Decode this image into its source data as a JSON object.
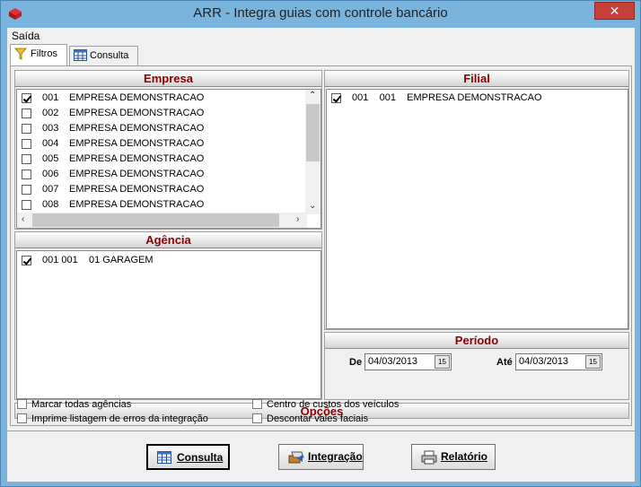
{
  "window": {
    "title": "ARR - Integra guias com controle bancário",
    "close_glyph": "✕"
  },
  "menu": {
    "items": [
      "Saída"
    ]
  },
  "tabs": [
    {
      "label": "Filtros",
      "icon": "funnel-icon"
    },
    {
      "label": "Consulta",
      "icon": "table-icon"
    }
  ],
  "empresa": {
    "title": "Empresa",
    "rows": [
      {
        "code": "001",
        "name": "EMPRESA DEMONSTRACAO",
        "checked": true
      },
      {
        "code": "002",
        "name": "EMPRESA DEMONSTRACAO",
        "checked": false
      },
      {
        "code": "003",
        "name": "EMPRESA DEMONSTRACAO",
        "checked": false
      },
      {
        "code": "004",
        "name": "EMPRESA DEMONSTRACAO",
        "checked": false
      },
      {
        "code": "005",
        "name": "EMPRESA DEMONSTRACAO",
        "checked": false
      },
      {
        "code": "006",
        "name": "EMPRESA DEMONSTRACAO",
        "checked": false
      },
      {
        "code": "007",
        "name": "EMPRESA DEMONSTRACAO",
        "checked": false
      },
      {
        "code": "008",
        "name": "EMPRESA DEMONSTRACAO",
        "checked": false
      }
    ]
  },
  "agencia": {
    "title": "Agência",
    "rows": [
      {
        "text": "001 001    01 GARAGEM",
        "checked": true
      }
    ]
  },
  "filial": {
    "title": "Filial",
    "rows": [
      {
        "text": "001    001    EMPRESA DEMONSTRACAO",
        "checked": true
      }
    ]
  },
  "periodo": {
    "title": "Período",
    "de_label": "De",
    "de_value": "04/03/2013",
    "ate_label": "Até",
    "ate_value": "04/03/2013",
    "cal_glyph": "15"
  },
  "opcoes": {
    "title": "Opções",
    "items": [
      {
        "label": "Marcar todas agências",
        "checked": false
      },
      {
        "label": "Imprime listagem de erros da integração",
        "checked": false
      },
      {
        "label": "Centro de custos dos veículos",
        "checked": false
      },
      {
        "label": "Descontar vales faciais",
        "checked": false
      }
    ]
  },
  "buttons": {
    "consulta": "Consulta",
    "integracao": "Integração",
    "relatorio": "Relatório"
  }
}
